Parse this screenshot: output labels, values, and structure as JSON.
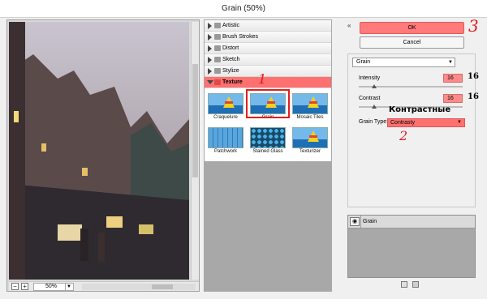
{
  "window": {
    "title": "Grain (50%)"
  },
  "preview": {
    "zoom": "50%",
    "zoom_out_symbol": "−",
    "zoom_in_symbol": "+"
  },
  "gallery": {
    "categories_before": [
      "Artistic",
      "Brush Strokes",
      "Distort",
      "Sketch",
      "Stylize"
    ],
    "open_category": "Texture",
    "thumbnails": [
      "Craquelure",
      "Grain",
      "Mosaic Tiles",
      "Patchwork",
      "Stained Glass",
      "Texturizer"
    ],
    "selected_thumbnail": "Grain"
  },
  "buttons": {
    "ok": "OK",
    "cancel": "Cancel",
    "collapse": "«"
  },
  "settings": {
    "filter": "Grain",
    "intensity_label": "Intensity",
    "intensity_value": "16",
    "contrast_label": "Contrast",
    "contrast_value": "16",
    "grain_type_label": "Grain Type:",
    "grain_type_value": "Contrasty"
  },
  "layers": {
    "name": "Grain"
  },
  "annotations": {
    "n1": "1",
    "n2": "2",
    "n3": "3",
    "side_intensity": "16",
    "side_contrast": "16",
    "russian": "Контрастные"
  },
  "colors": {
    "highlight": "#ff7070",
    "annotation_red": "#e21a1a"
  },
  "icons": {
    "expand": "arrow-right",
    "collapse": "arrow-down",
    "folder": "folder",
    "eye": "eye",
    "new_layer": "new-layer",
    "delete": "trash"
  }
}
